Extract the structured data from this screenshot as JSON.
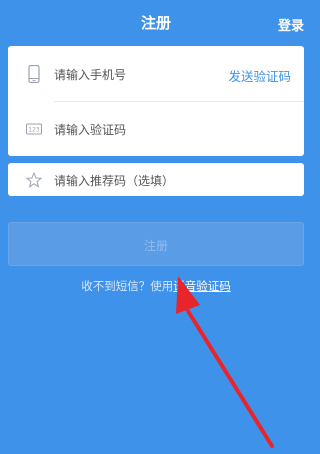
{
  "header": {
    "title": "注册",
    "login_label": "登录"
  },
  "form": {
    "phone_placeholder": "请输入手机号",
    "send_code_label": "发送验证码",
    "code_placeholder": "请输入验证码",
    "referral_placeholder": "请输入推荐码（选填）"
  },
  "register_button_label": "注册",
  "voice_hint": {
    "prefix": "收不到短信？使用",
    "link": "语音验证码"
  },
  "colors": {
    "background": "#3F92EA",
    "annotation_arrow": "#E8252B"
  },
  "icons": {
    "phone": "phone-icon",
    "code": "code-icon",
    "star": "star-icon",
    "annotation": "red-arrow-icon"
  }
}
